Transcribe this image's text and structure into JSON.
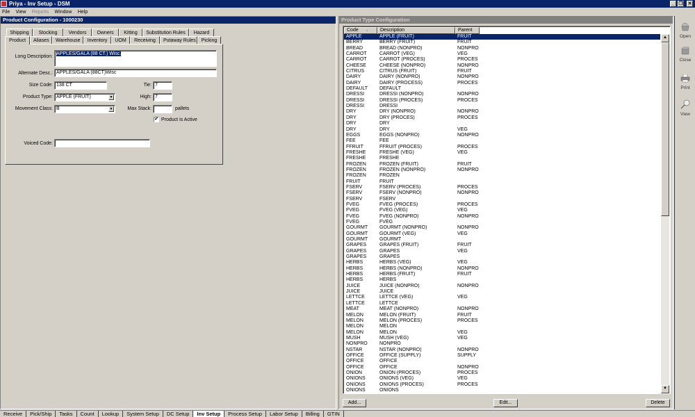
{
  "window": {
    "title": "Priya - Inv Setup - DSM",
    "controls": {
      "minimize": "_",
      "restore": "❐",
      "close": "✕"
    }
  },
  "menu": [
    "File",
    "View",
    "Reports",
    "Window",
    "Help"
  ],
  "menu_disabled": [
    "Reports"
  ],
  "product_config": {
    "caption": "Product Configuration - 1000230",
    "tabs_back": [
      "Shipping",
      "Stocking",
      "Vendors",
      "Owners",
      "Kitting",
      "Substitution Rules",
      "Hazard"
    ],
    "tabs_front": [
      "Product",
      "Aliases",
      "Warehouse",
      "Inventory",
      "UOM",
      "Receiving",
      "Putaway Rules",
      "Picking"
    ],
    "active_tab": "Product",
    "fields": {
      "long_description": {
        "label": "Long Description:",
        "value": "APPLES/GALA (88 CT.) Wisc."
      },
      "alternate_desc": {
        "label": "Alternate Desc.:",
        "value": "APPLES/GALA (88CT)Wisc"
      },
      "size_code": {
        "label": "Size Code:",
        "value": "138 CT"
      },
      "product_type": {
        "label": "Product Type:",
        "value": "APPLE (FRUIT)"
      },
      "movement_class": {
        "label": "Movement Class:",
        "value": "B"
      },
      "tie": {
        "label": "Tie:",
        "value": "7"
      },
      "high": {
        "label": "High:",
        "value": "7"
      },
      "max_stack": {
        "label": "Max Stack:",
        "value": "",
        "unit": "pallets"
      },
      "product_is_active": {
        "label": "Product is Active",
        "checked": true
      },
      "voiced_code": {
        "label": "Voiced Code:",
        "value": ""
      }
    }
  },
  "product_type_config": {
    "caption": "Product Type Configuration",
    "columns": [
      "Code",
      "Description",
      "Parent"
    ],
    "sort_indicator": "▲",
    "selected_index": 0,
    "rows": [
      [
        "APPLE",
        "APPLE (FRUIT)",
        "FRUIT"
      ],
      [
        "BERRY",
        "BERRY (FRUIT)",
        "FRUIT"
      ],
      [
        "BREAD",
        "BREAD (NONPRO)",
        "NONPRO"
      ],
      [
        "CARROT",
        "CARROT (VEG)",
        "VEG"
      ],
      [
        "CARROT",
        "CARROT (PROCES)",
        "PROCES"
      ],
      [
        "CHEESE",
        "CHEESE (NONPRO)",
        "NONPRO"
      ],
      [
        "CITRUS",
        "CITRUS (FRUIT)",
        "FRUIT"
      ],
      [
        "DAIRY",
        "DAIRY (NONPRO)",
        "NONPRO"
      ],
      [
        "DAIRY",
        "DAIRY (PROCESS)",
        "PROCES"
      ],
      [
        "DEFAULT",
        "DEFAULT",
        ""
      ],
      [
        "DRESSI",
        "DRESSI (NONPRO)",
        "NONPRO"
      ],
      [
        "DRESSI",
        "DRESSI (PROCES)",
        "PROCES"
      ],
      [
        "DRESSI",
        "DRESSI",
        ""
      ],
      [
        "DRY",
        "DRY (NONPRO)",
        "NONPRO"
      ],
      [
        "DRY",
        "DRY (PROCES)",
        "PROCES"
      ],
      [
        "DRY",
        "DRY",
        ""
      ],
      [
        "DRY",
        "DRY",
        "VEG"
      ],
      [
        "EGGS",
        "EGGS (NONPRO)",
        "NONPRO"
      ],
      [
        "FEE",
        "FEE",
        ""
      ],
      [
        "FFRUIT",
        "FFRUIT (PROCES)",
        "PROCES"
      ],
      [
        "FRESHE",
        "FRESHE (VEG)",
        "VEG"
      ],
      [
        "FRESHE",
        "FRESHE",
        ""
      ],
      [
        "FROZEN",
        "FROZEN (FRUIT)",
        "FRUIT"
      ],
      [
        "FROZEN",
        "FROZEN (NONPRO)",
        "NONPRO"
      ],
      [
        "FROZEN",
        "FROZEN",
        ""
      ],
      [
        "FRUIT",
        "FRUIT",
        ""
      ],
      [
        "FSERV",
        "FSERV (PROCES)",
        "PROCES"
      ],
      [
        "FSERV",
        "FSERV (NONPRO)",
        "NONPRO"
      ],
      [
        "FSERV",
        "FSERV",
        ""
      ],
      [
        "FVEG",
        "FVEG (PROCES)",
        "PROCES"
      ],
      [
        "FVEG",
        "FVEG (VEG)",
        "VEG"
      ],
      [
        "FVEG",
        "FVEG (NONPRO)",
        "NONPRO"
      ],
      [
        "FVEG",
        "FVEG",
        ""
      ],
      [
        "GOURMT",
        "GOURMT (NONPRO)",
        "NONPRO"
      ],
      [
        "GOURMT",
        "GOURMT (VEG)",
        "VEG"
      ],
      [
        "GOURMT",
        "GOURMT",
        ""
      ],
      [
        "GRAPES",
        "GRAPES (FRUIT)",
        "FRUIT"
      ],
      [
        "GRAPES",
        "GRAPES",
        "VEG"
      ],
      [
        "GRAPES",
        "GRAPES",
        ""
      ],
      [
        "HERBS",
        "HERBS (VEG)",
        "VEG"
      ],
      [
        "HERBS",
        "HERBS (NONPRO)",
        "NONPRO"
      ],
      [
        "HERBS",
        "HERBS (FRUIT)",
        "FRUIT"
      ],
      [
        "HERBS",
        "HERBS",
        ""
      ],
      [
        "JUICE",
        "JUICE (NONPRO)",
        "NONPRO"
      ],
      [
        "JUICE",
        "JUICE",
        ""
      ],
      [
        "LETTCE",
        "LETTCE (VEG)",
        "VEG"
      ],
      [
        "LETTCE",
        "LETTCE",
        ""
      ],
      [
        "MEAT",
        "MEAT (NONPRO)",
        "NONPRO"
      ],
      [
        "MELON",
        "MELON (FRUIT)",
        "FRUIT"
      ],
      [
        "MELON",
        "MELON (PROCES)",
        "PROCES"
      ],
      [
        "MELON",
        "MELON",
        ""
      ],
      [
        "MELON",
        "MELON",
        "VEG"
      ],
      [
        "MUSH",
        "MUSH (VEG)",
        "VEG"
      ],
      [
        "NONPRO",
        "NONPRO",
        ""
      ],
      [
        "NSTAR",
        "NSTAR (NONPRO)",
        "NONPRO"
      ],
      [
        "OFFICE",
        "OFFICE (SUPPLY)",
        "SUPPLY"
      ],
      [
        "OFFICE",
        "OFFICE",
        ""
      ],
      [
        "OFFICE",
        "OFFICE",
        "NONPRO"
      ],
      [
        "ONION",
        "ONION (PROCES)",
        "PROCES"
      ],
      [
        "ONIONS",
        "ONIONS (VEG)",
        "VEG"
      ],
      [
        "ONIONS",
        "ONIONS (PROCES)",
        "PROCES"
      ],
      [
        "ONIONS",
        "ONIONS",
        ""
      ]
    ],
    "buttons": {
      "add": "Add...",
      "edit": "Edit...",
      "delete": "Delete"
    }
  },
  "toolbar": [
    {
      "label": "Open",
      "icon": "open-box-icon"
    },
    {
      "label": "Close",
      "icon": "closed-box-icon"
    },
    {
      "label": "Print",
      "icon": "printer-icon"
    },
    {
      "label": "View",
      "icon": "magnifier-icon"
    }
  ],
  "bottom_tabs": [
    "Receive",
    "Pick/Ship",
    "Tasks",
    "Count",
    "Lookup",
    "System Setup",
    "DC Setup",
    "Inv Setup",
    "Process Setup",
    "Labor Setup",
    "Billing",
    "GTIN"
  ],
  "bottom_active": "Inv Setup"
}
